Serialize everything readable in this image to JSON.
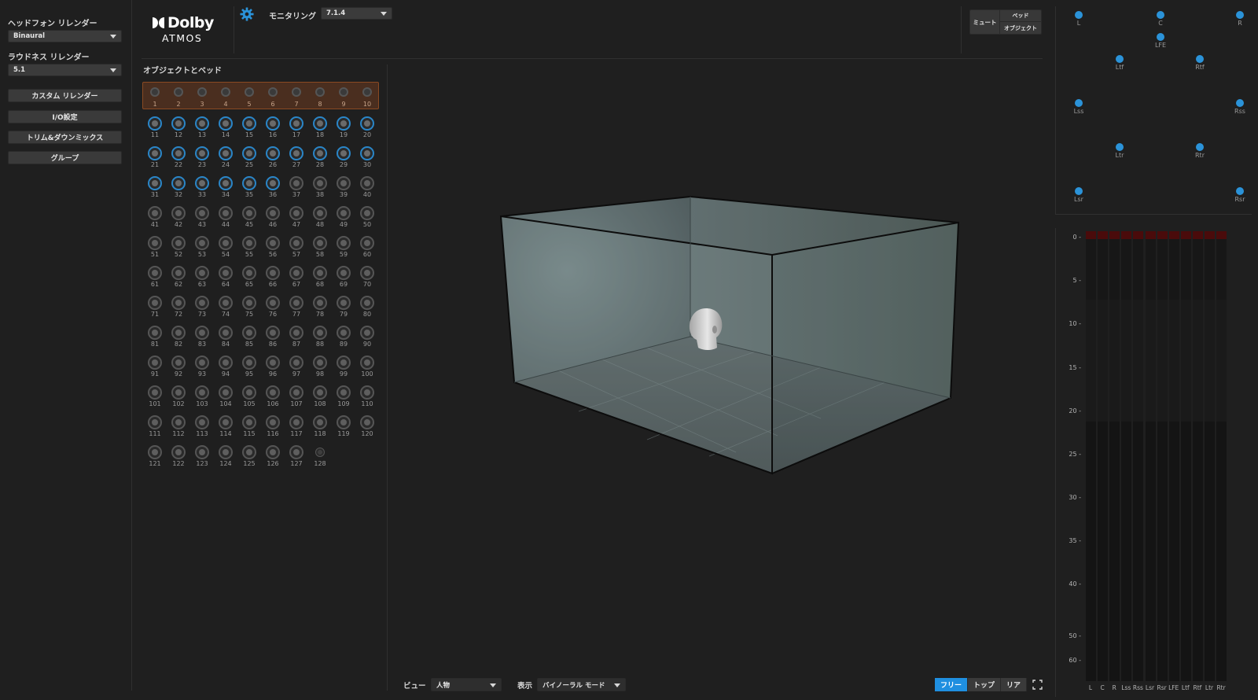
{
  "left_panel": {
    "headphone_label": "ヘッドフォン リレンダー",
    "headphone_value": "Binaural",
    "loudness_label": "ラウドネス リレンダー",
    "loudness_value": "5.1",
    "buttons": [
      "カスタム リレンダー",
      "I/O設定",
      "トリム&ダウンミックス",
      "グループ"
    ]
  },
  "header": {
    "logo_brand": "Dolby",
    "logo_sub": "ATMOS",
    "monitoring_label": "モニタリング",
    "monitoring_value": "7.1.4",
    "mute_label": "ミュート",
    "bed_label": "ベッド",
    "object_label": "オブジェクト"
  },
  "objects": {
    "title": "オブジェクトとベッド",
    "total": 128,
    "bed_count": 10,
    "active_ids": [
      11,
      12,
      13,
      14,
      15,
      16,
      17,
      18,
      19,
      20,
      21,
      22,
      23,
      24,
      25,
      26,
      27,
      28,
      29,
      30,
      31,
      32,
      33,
      34,
      35,
      36
    ],
    "small_ids": [
      128
    ]
  },
  "bottom": {
    "view_label": "ビュー",
    "view_value": "人物",
    "display_label": "表示",
    "display_value": "バイノーラル モード",
    "camera_buttons": [
      "フリー",
      "トップ",
      "リア"
    ],
    "camera_selected": "フリー"
  },
  "speakers": [
    "L",
    "C",
    "R",
    "LFE",
    "Ltf",
    "Rtf",
    "Lss",
    "Rss",
    "Ltr",
    "Rtr",
    "Lsr",
    "Rsr"
  ],
  "meter": {
    "scale": [
      "0",
      "5",
      "10",
      "15",
      "20",
      "25",
      "30",
      "35",
      "40",
      "50",
      "60"
    ],
    "channels": [
      "L",
      "C",
      "R",
      "Lss",
      "Rss",
      "Lsr",
      "Rsr",
      "LFE",
      "Ltf",
      "Rtf",
      "Ltr",
      "Rtr"
    ]
  },
  "colors": {
    "accent": "#1f8fe0",
    "active_ring": "#2a86c8",
    "bed_bg": "#4a2e1f",
    "bed_border": "#8a4a22",
    "peak": "#4a0b0b"
  }
}
